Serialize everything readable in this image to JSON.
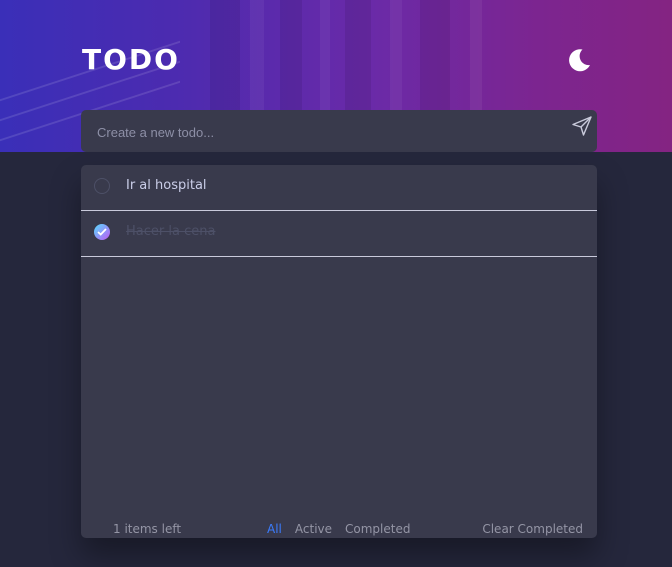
{
  "header": {
    "title": "TODO",
    "theme_icon": "moon-icon"
  },
  "new_todo": {
    "placeholder": "Create a new todo...",
    "value": "",
    "submit_icon": "send-icon"
  },
  "todos": [
    {
      "text": "Ir al hospital",
      "completed": false
    },
    {
      "text": "Hacer la cena",
      "completed": true
    }
  ],
  "footer": {
    "items_left": "1 items left",
    "filters": [
      {
        "label": "All",
        "active": true
      },
      {
        "label": "Active",
        "active": false
      },
      {
        "label": "Completed",
        "active": false
      }
    ],
    "clear_label": "Clear Completed"
  },
  "colors": {
    "background": "#25273c",
    "card": "#393a4c",
    "accent": "#3a7cfd",
    "check_gradient_start": "#57ddff",
    "check_gradient_end": "#c058f3"
  }
}
